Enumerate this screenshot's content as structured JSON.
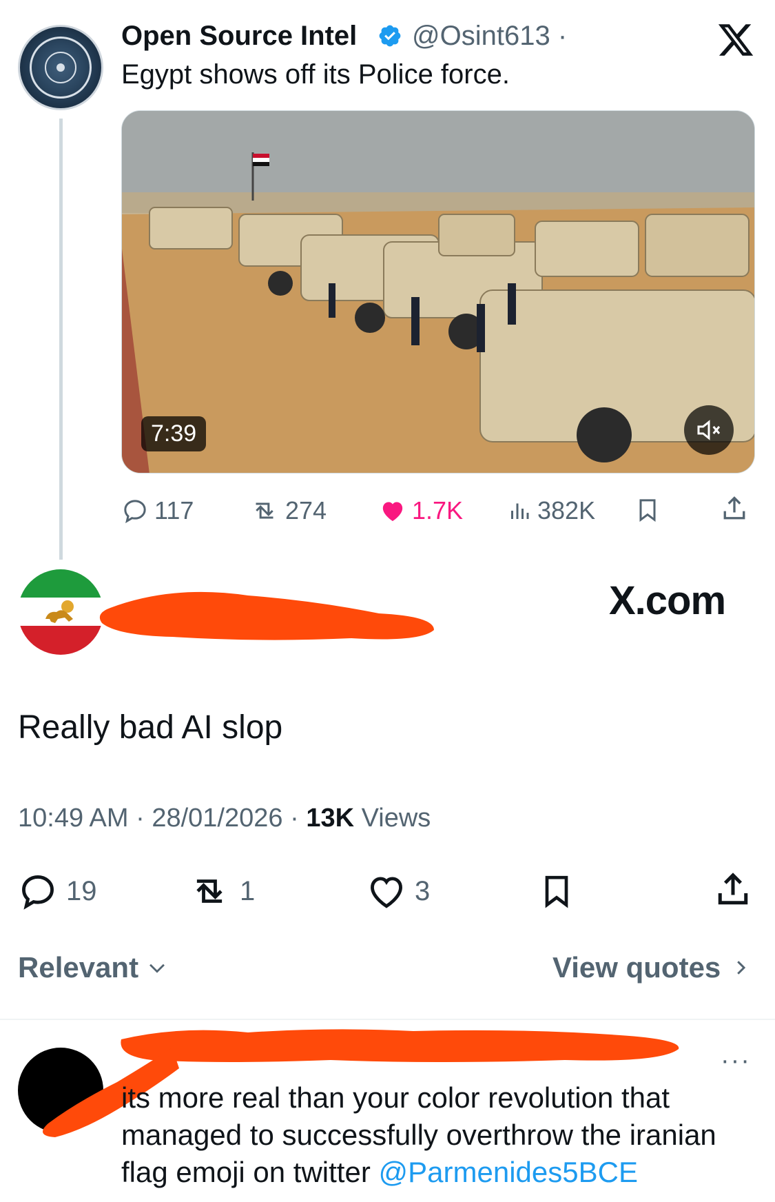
{
  "original_tweet": {
    "author_name": "Open Source Intel",
    "author_handle": "@Osint613 ·",
    "text": "Egypt shows off its Police force.",
    "video_duration": "7:39",
    "stats": {
      "replies": "117",
      "reposts": "274",
      "likes": "1.7K",
      "views": "382K"
    }
  },
  "watermark": "X.com",
  "reply_tweet": {
    "text": "Really bad AI slop",
    "time": "10:49 AM",
    "date": "28/01/2026",
    "views_count": "13K",
    "views_label": "Views",
    "actions": {
      "replies": "19",
      "reposts": "1",
      "likes": "3"
    }
  },
  "controls": {
    "relevant_label": "Relevant",
    "view_quotes_label": "View quotes"
  },
  "bottom_reply": {
    "more": "···",
    "text_before": "its more real than your color revolution that managed to successfully overthrow the iranian flag emoji on twitter ",
    "mention": "@Parmenides5BCE"
  },
  "colors": {
    "accent": "#1d9bf0",
    "like": "#f91880",
    "muted": "#536471",
    "redaction": "#ff4a0a"
  }
}
